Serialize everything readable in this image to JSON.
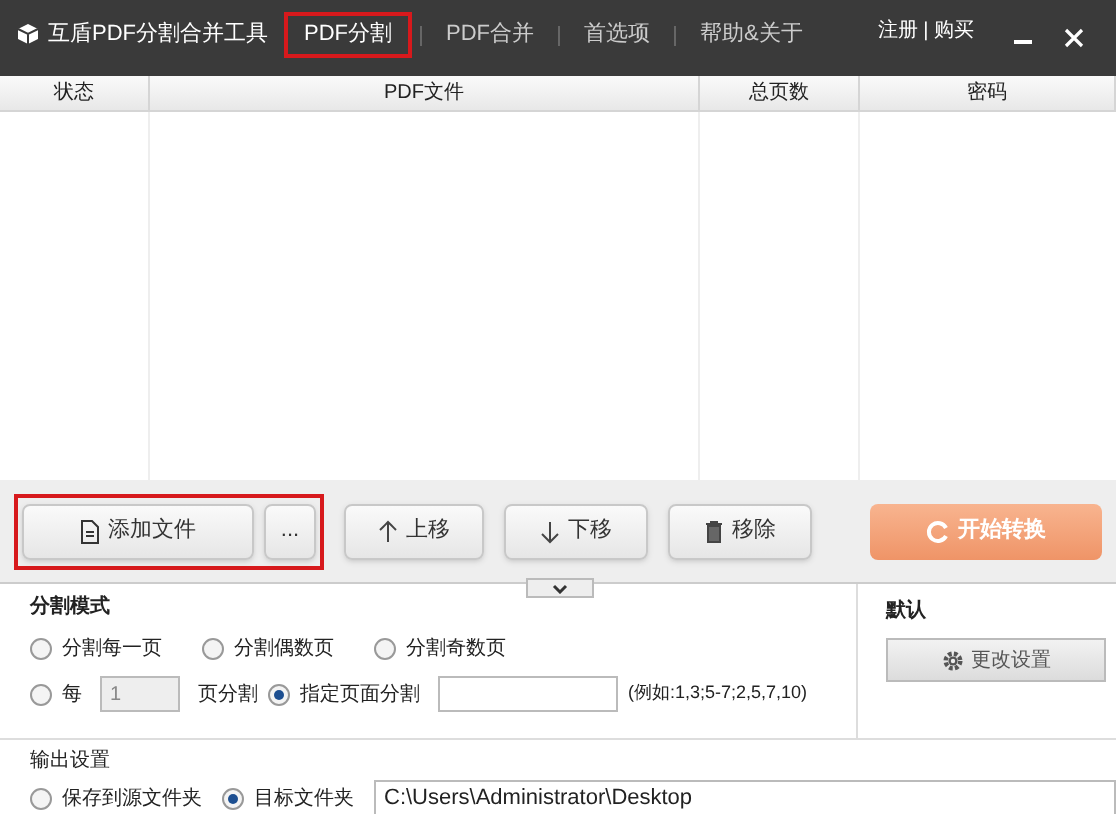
{
  "window": {
    "title": "互盾PDF分割合并工具",
    "account_links": "注册 | 购买"
  },
  "tabs": [
    {
      "label": "PDF分割",
      "selected": true
    },
    {
      "label": "PDF合并",
      "selected": false
    },
    {
      "label": "首选项",
      "selected": false
    },
    {
      "label": "帮助&关于",
      "selected": false
    }
  ],
  "table": {
    "columns": [
      "状态",
      "PDF文件",
      "总页数",
      "密码"
    ]
  },
  "toolbar": {
    "add_file": "添加文件",
    "more": "...",
    "move_up": "上移",
    "move_down": "下移",
    "remove": "移除",
    "start": "开始转换"
  },
  "split_mode": {
    "title": "分割模式",
    "options": [
      {
        "label": "分割每一页",
        "selected": false
      },
      {
        "label": "分割偶数页",
        "selected": false
      },
      {
        "label": "分割奇数页",
        "selected": false
      }
    ],
    "every": {
      "label": "每",
      "value": "1",
      "suffix": "页分割",
      "selected": false
    },
    "specified": {
      "label": "指定页面分割",
      "selected": true,
      "hint": "(例如:1,3;5-7;2,5,7,10)"
    }
  },
  "defaults": {
    "title": "默认",
    "button": "更改设置"
  },
  "output": {
    "title": "输出设置",
    "options": [
      {
        "label": "保存到源文件夹",
        "selected": false
      },
      {
        "label": "目标文件夹",
        "selected": true
      }
    ],
    "path": "C:\\Users\\Administrator\\Desktop"
  }
}
